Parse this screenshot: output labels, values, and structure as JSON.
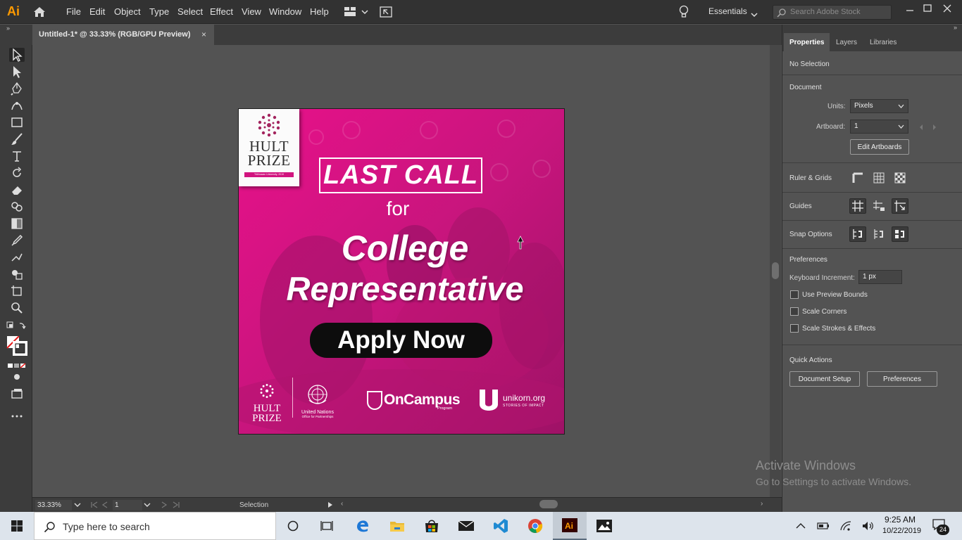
{
  "app": {
    "logo": "Ai",
    "menu": [
      "File",
      "Edit",
      "Object",
      "Type",
      "Select",
      "Effect",
      "View",
      "Window",
      "Help"
    ],
    "workspace": "Essentials",
    "stock_search_placeholder": "Search Adobe Stock"
  },
  "document_tab": {
    "title": "Untitled-1* @ 33.33% (RGB/GPU Preview)",
    "close": "×"
  },
  "artwork": {
    "card_logo_text": "HULT\nPRIZE",
    "card_logo_subtext": "Tribhuwan University, 2019",
    "headline_box": "LAST CALL",
    "connector": "for",
    "line1": "College",
    "line2": "Representative",
    "cta": "Apply Now",
    "partner_hult": "HULT\nPRIZE",
    "partner_un_name": "United Nations",
    "partner_un_office": "Office for Partnerships",
    "partner_oncampus": "OnCampus",
    "partner_oncampus_sub": "Program",
    "partner_unikorn": "unikorn.org",
    "partner_unikorn_sub": "STORIES OF IMPACT",
    "colors": {
      "magenta": "#e0117f",
      "dark_magenta": "#a41266",
      "cta_bg": "#0d0d0d"
    }
  },
  "status_bar": {
    "zoom": "33.33%",
    "artboard_number": "1",
    "current_tool": "Selection"
  },
  "properties": {
    "tabs": [
      "Properties",
      "Layers",
      "Libraries"
    ],
    "selection_state": "No Selection",
    "document_title": "Document",
    "units_label": "Units:",
    "units_value": "Pixels",
    "artboard_label": "Artboard:",
    "artboard_value": "1",
    "edit_artboards": "Edit Artboards",
    "rulers_grids": "Ruler & Grids",
    "guides": "Guides",
    "snap_options": "Snap Options",
    "preferences_title": "Preferences",
    "keyboard_increment_label": "Keyboard Increment:",
    "keyboard_increment_value": "1 px",
    "checkboxes": [
      "Use Preview Bounds",
      "Scale Corners",
      "Scale Strokes & Effects"
    ],
    "quick_actions_title": "Quick Actions",
    "document_setup": "Document Setup",
    "preferences_button": "Preferences"
  },
  "watermark": {
    "title": "Activate Windows",
    "subtitle": "Go to Settings to activate Windows."
  },
  "taskbar": {
    "search_placeholder": "Type here to search",
    "time": "9:25 AM",
    "date": "10/22/2019",
    "notification_count": "24",
    "pinned": [
      "task-view",
      "edge",
      "file-explorer",
      "store",
      "mail",
      "vscode",
      "chrome",
      "illustrator",
      "photos"
    ]
  }
}
